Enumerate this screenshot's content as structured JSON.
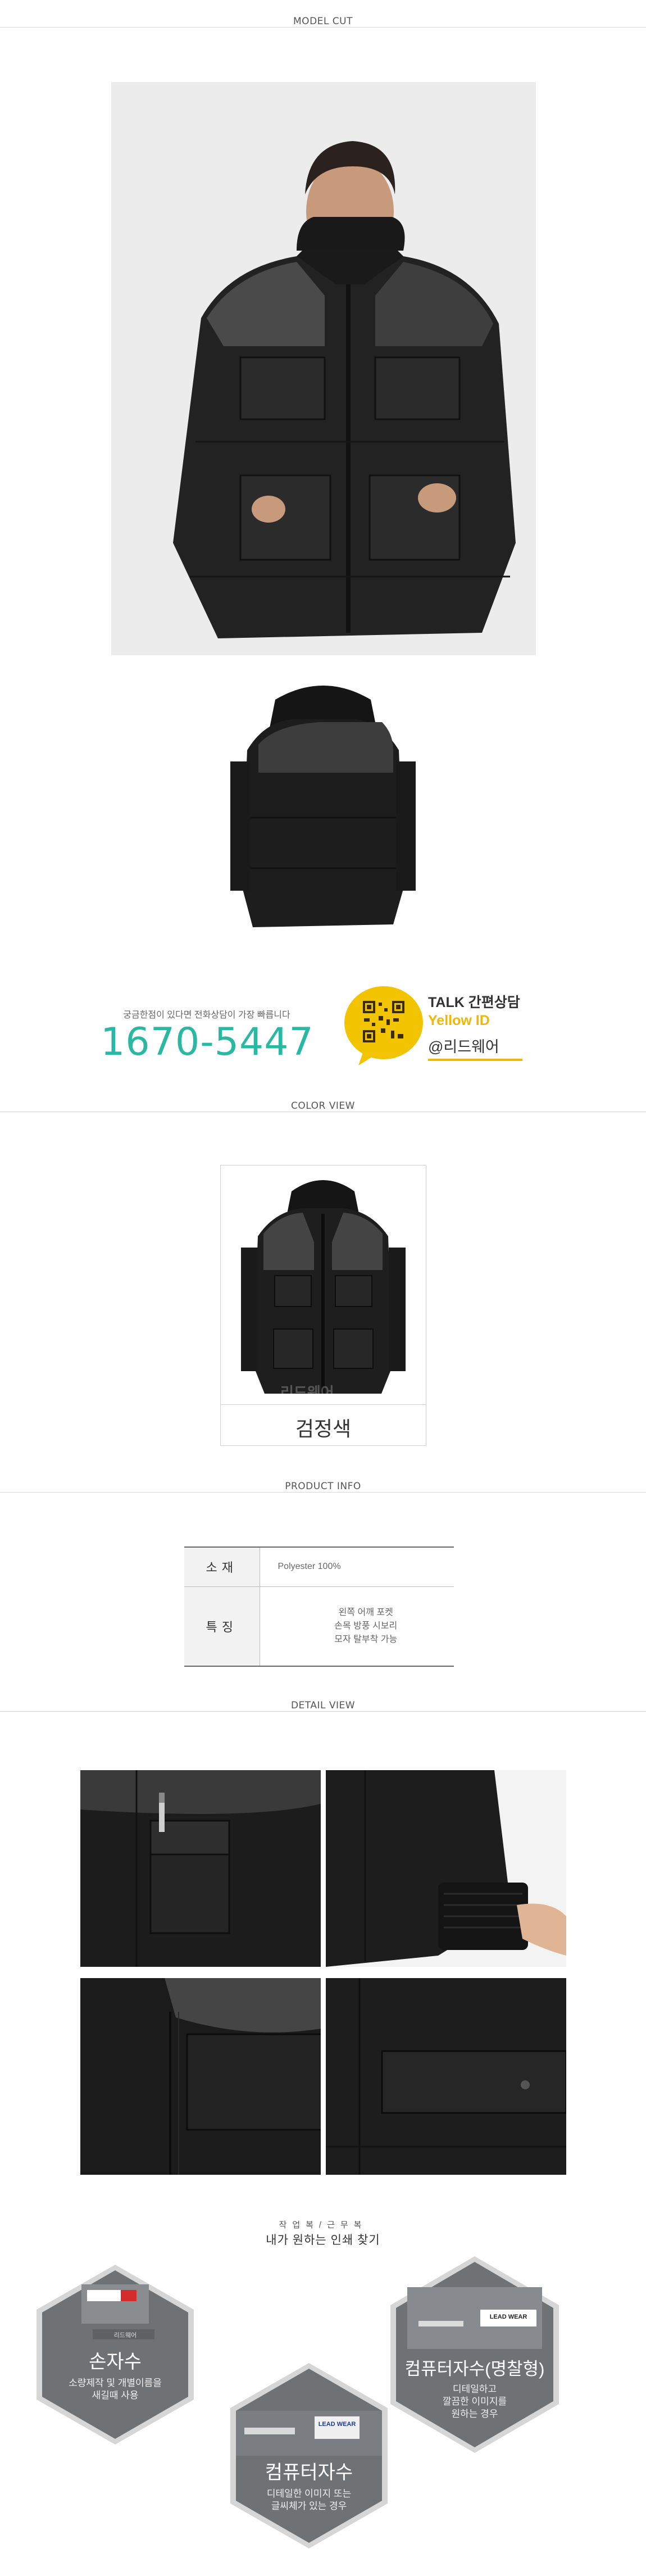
{
  "sections": {
    "model_cut": "MODEL CUT",
    "color_view": "COLOR VIEW",
    "product_info": "PRODUCT INFO",
    "detail_view": "DETAIL VIEW"
  },
  "contact": {
    "subtitle": "궁금한점이 있다면 전화상담이 가장 빠릅니다",
    "phone": "1670-5447",
    "talk_word": "TALK",
    "talk_label": "간편상담",
    "yellow_id": "Yellow ID",
    "kakao_id": "@리드웨어"
  },
  "color_view": {
    "color_name": "검정색",
    "watermark": "리드웨어"
  },
  "product_info": {
    "rows": [
      {
        "key": "소재",
        "value": "Polyester 100%"
      },
      {
        "key": "특징",
        "lines": [
          "왼쪽 어깨 포켓",
          "손목 방풍 시보리",
          "모자 탈부착 가능"
        ]
      }
    ]
  },
  "bottom": {
    "small_title": "작업복/근무복",
    "title": "내가 원하는 인쇄 찾기",
    "items": [
      {
        "title": "손자수",
        "desc1": "소량제작 및 개별이름을",
        "desc2": "새길때 사용",
        "badge": "리드웨어"
      },
      {
        "title": "컴퓨터자수",
        "desc1": "디테일한 이미지 또는",
        "desc2": "글씨체가 있는 경우",
        "badge": "LEAD WEAR"
      },
      {
        "title": "컴퓨터자수(명찰형)",
        "desc1": "디테일하고",
        "desc2": "깔끔한 이미지를",
        "desc3": "원하는 경우",
        "badge": "LEAD WEAR"
      }
    ]
  },
  "colors": {
    "accent_teal": "#2bb8a3",
    "kakao_yellow": "#f2b705",
    "jacket_black": "#1e1e1e",
    "hex_gray": "#6f7275"
  }
}
